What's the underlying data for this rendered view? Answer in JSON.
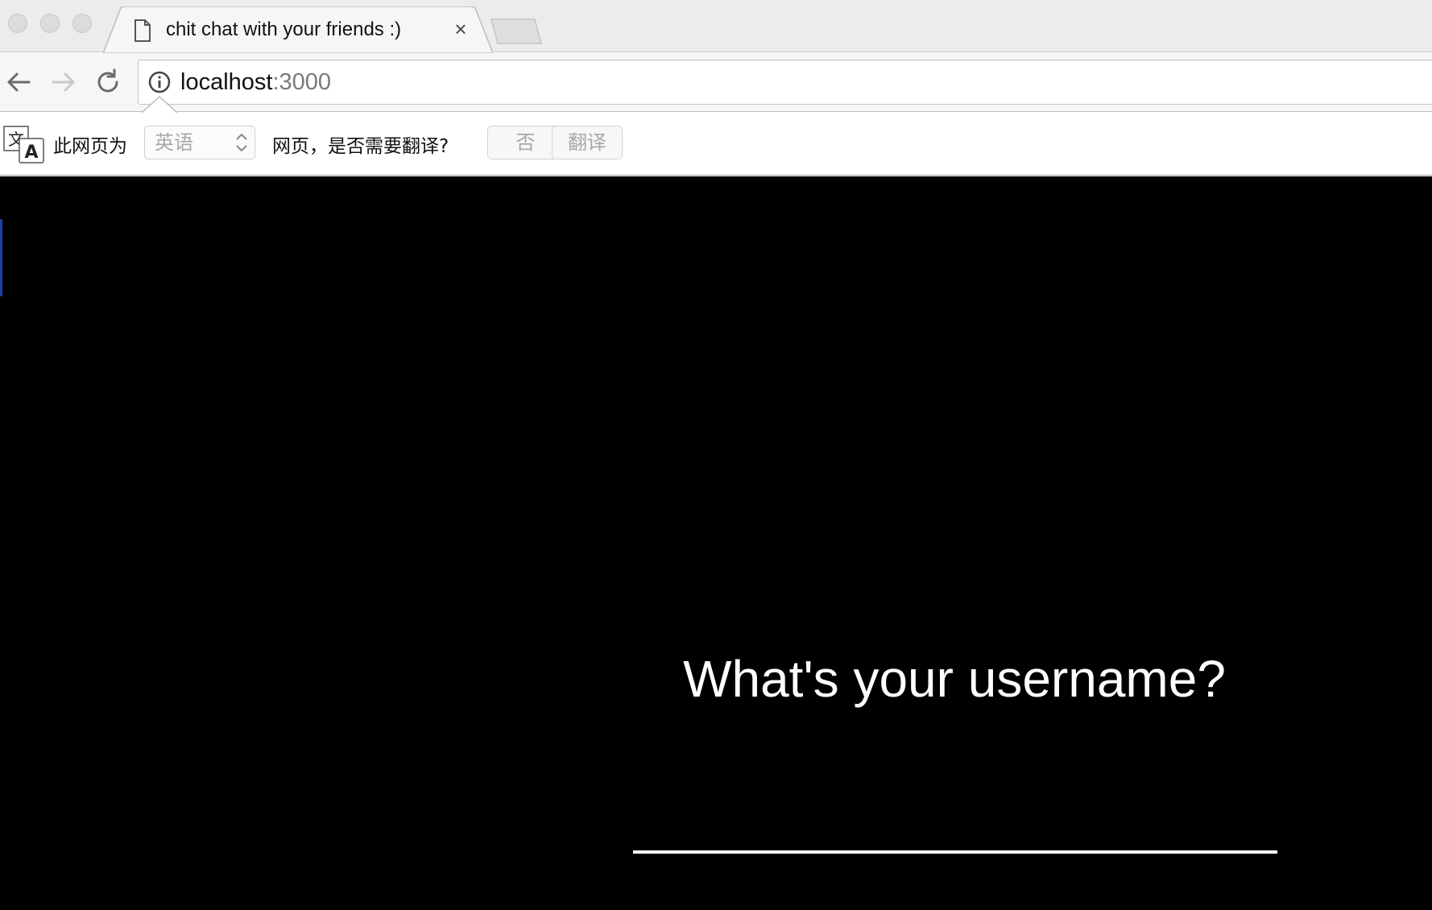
{
  "window": {
    "tab": {
      "title": "chit chat with your friends :)",
      "close_glyph": "×",
      "icon": "file-icon"
    }
  },
  "toolbar": {
    "back_icon": "back-arrow-icon",
    "forward_icon": "forward-arrow-icon",
    "reload_icon": "reload-icon",
    "url_host": "localhost",
    "url_port": ":3000",
    "site_info_icon": "info-icon"
  },
  "translate_bar": {
    "icon": "translate-icon",
    "prefix_text": "此网页为",
    "language_selected": "英语",
    "suffix_text": "网页，是否需要翻译?",
    "no_button": "否",
    "translate_button": "翻译"
  },
  "page": {
    "background": "#000000",
    "prompt": "What's your username?",
    "username_value": "",
    "text_color": "#ffffff"
  }
}
